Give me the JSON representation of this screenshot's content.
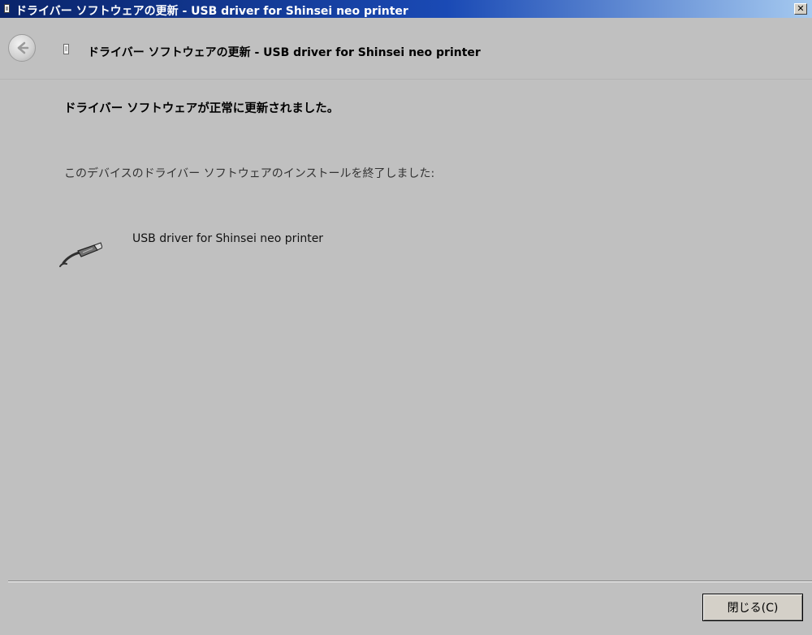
{
  "window": {
    "title": "ドライバー ソフトウェアの更新 - USB driver for Shinsei neo printer",
    "close_glyph": "✕"
  },
  "nav": {
    "title": "ドライバー ソフトウェアの更新 - USB driver for Shinsei neo printer"
  },
  "main": {
    "heading": "ドライバー ソフトウェアが正常に更新されました。",
    "description": "このデバイスのドライバー ソフトウェアのインストールを終了しました:",
    "device_name": "USB driver for Shinsei neo printer",
    "device_icon": "usb-plug-icon"
  },
  "footer": {
    "close_label": "閉じる(C)"
  },
  "colors": {
    "titlebar_start": "#0a246a",
    "titlebar_end": "#a6caf0",
    "dialog_bg": "#c0c0c0"
  }
}
